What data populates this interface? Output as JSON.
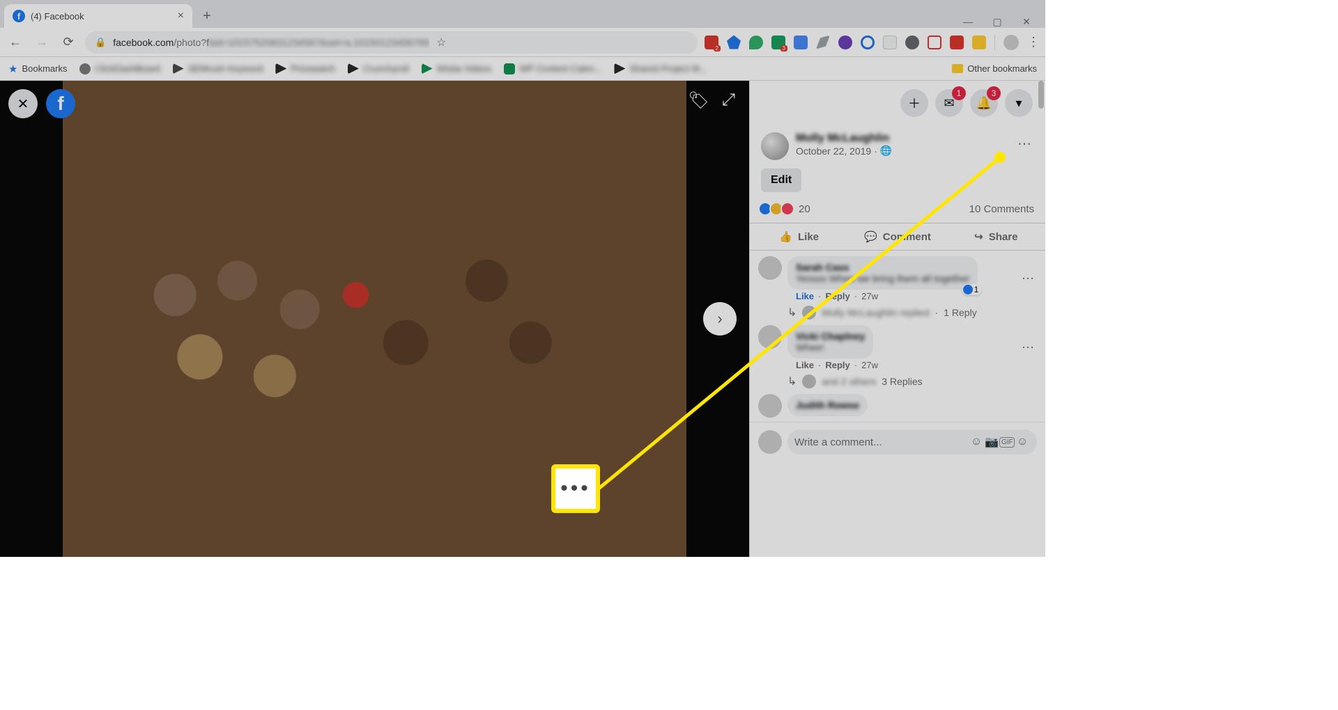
{
  "browser": {
    "tab_title": "(4) Facebook",
    "url_domain": "facebook.com",
    "url_path_visible": "/photo?f",
    "bookmarks_label": "Bookmarks",
    "other_bookmarks": "Other bookmarks"
  },
  "header_badges": {
    "messenger": "1",
    "notifications": "3"
  },
  "post": {
    "author": "Molly McLaughlin",
    "date": "October 22, 2019",
    "privacy_glyph": "🌐",
    "edit_label": "Edit",
    "reaction_count": "20",
    "comments_count_label": "10 Comments"
  },
  "actions": {
    "like": "Like",
    "comment": "Comment",
    "share": "Share"
  },
  "comments": [
    {
      "name": "Sarah Cass",
      "text": "Yessss When we bring them all together",
      "like_count": "1",
      "actions": {
        "like": "Like",
        "reply": "Reply",
        "age": "27w"
      },
      "reply_line": {
        "text": "Molly McLaughlin replied",
        "count": "1 Reply"
      }
    },
    {
      "name": "Vicki Chaplney",
      "text": "Whee!",
      "actions": {
        "like": "Like",
        "reply": "Reply",
        "age": "27w"
      },
      "reply_line": {
        "text": "and 2 others",
        "count": "3 Replies"
      }
    },
    {
      "name": "Judith Rowse",
      "text": ""
    }
  ],
  "composer": {
    "placeholder": "Write a comment..."
  },
  "callout_glyph": "•••"
}
